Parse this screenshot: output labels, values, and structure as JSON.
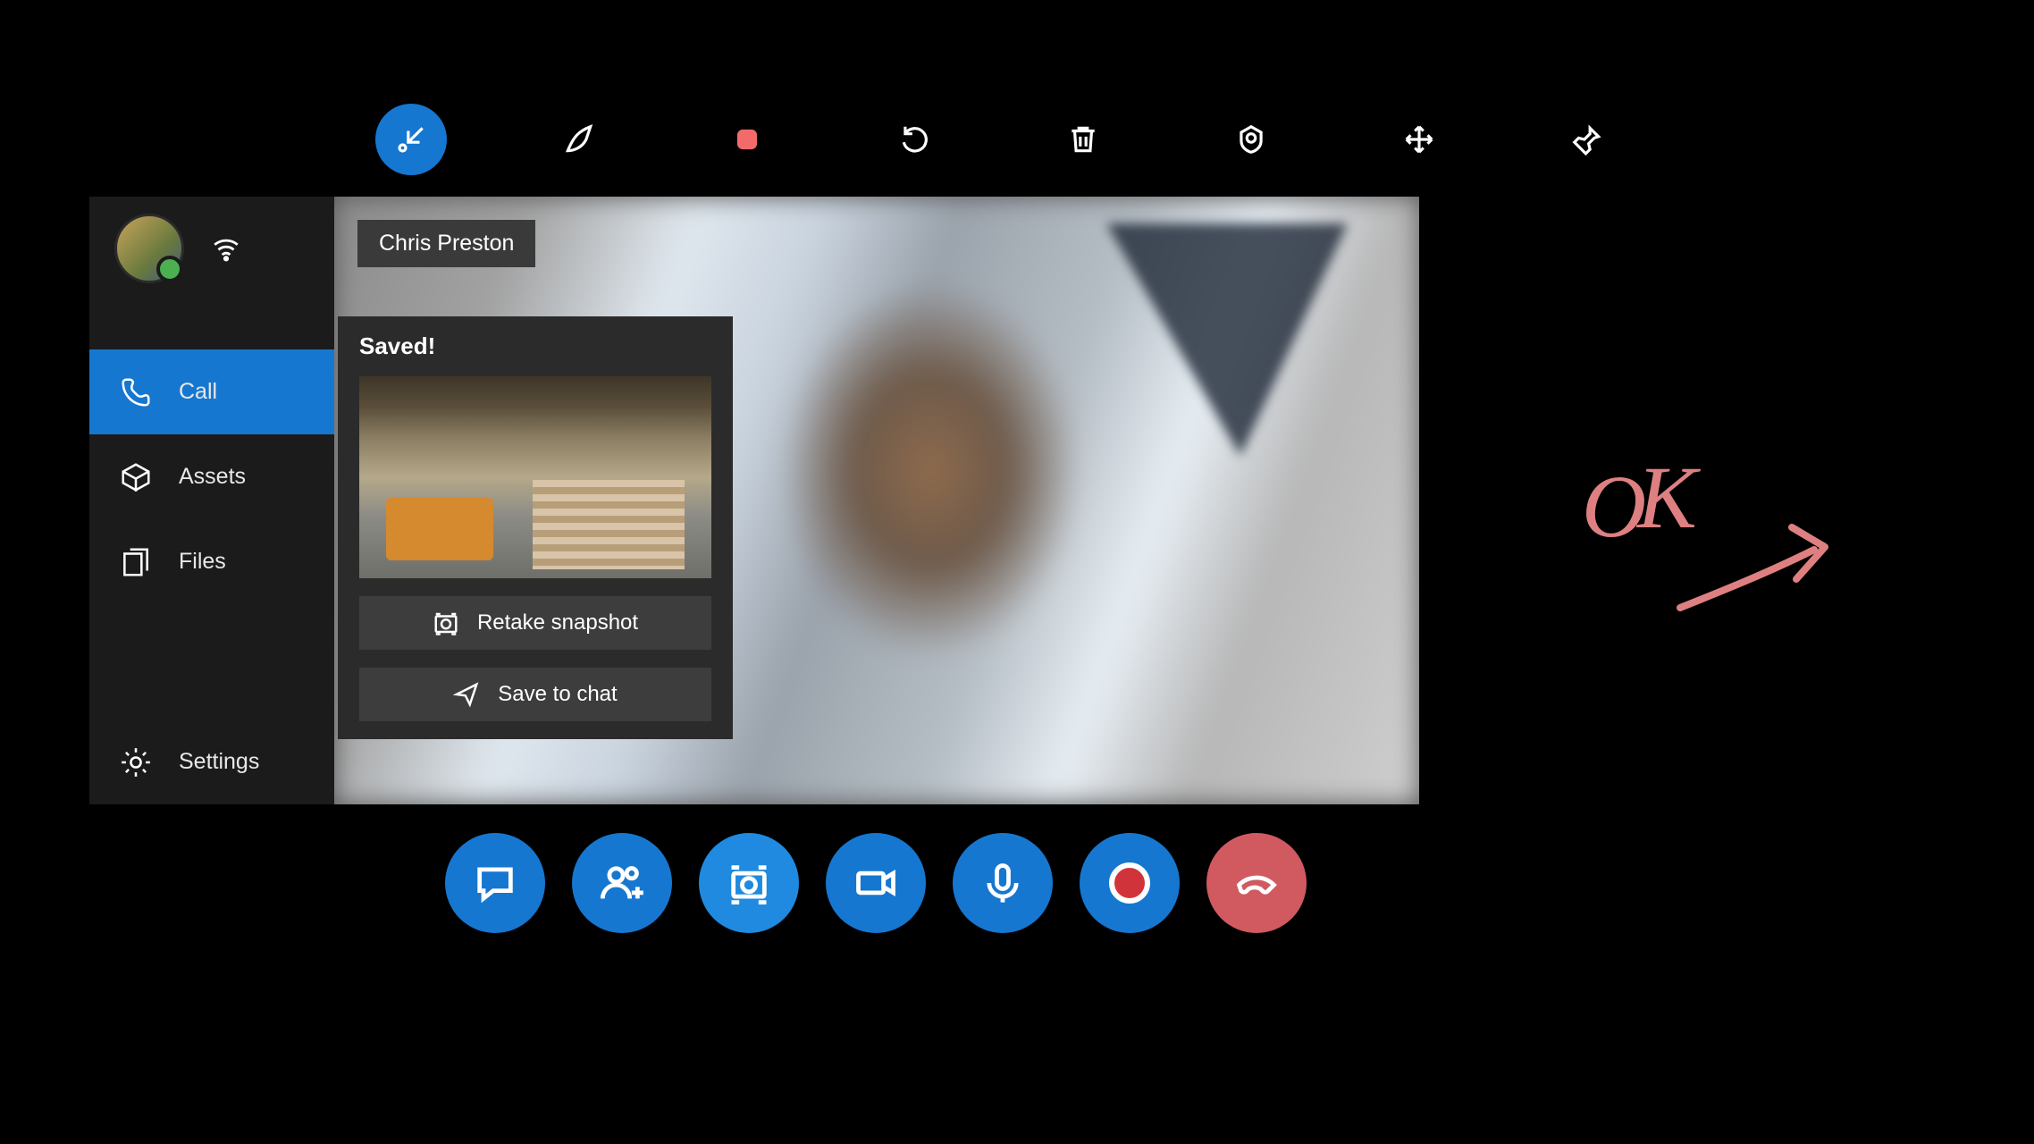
{
  "toolbar": {
    "items": [
      "collapse",
      "ink",
      "shape",
      "undo",
      "delete",
      "annotate",
      "move",
      "pin"
    ],
    "active_index": 0,
    "shape_color": "#f26a6a"
  },
  "sidebar": {
    "items": [
      {
        "label": "Call",
        "icon": "phone-icon",
        "selected": true
      },
      {
        "label": "Assets",
        "icon": "box-icon",
        "selected": false
      },
      {
        "label": "Files",
        "icon": "files-icon",
        "selected": false
      }
    ],
    "footer": {
      "label": "Settings",
      "icon": "gear-icon"
    }
  },
  "caller": {
    "name": "Chris Preston"
  },
  "snapshot": {
    "status": "Saved!",
    "retake_label": "Retake snapshot",
    "save_label": "Save to chat"
  },
  "controls": {
    "items": [
      "chat",
      "add-people",
      "snapshot",
      "video",
      "mic",
      "record",
      "hangup"
    ]
  },
  "annotation": {
    "text": "OK"
  },
  "colors": {
    "accent": "#1677d0",
    "hangup": "#d05a60",
    "ink": "#de8081"
  }
}
